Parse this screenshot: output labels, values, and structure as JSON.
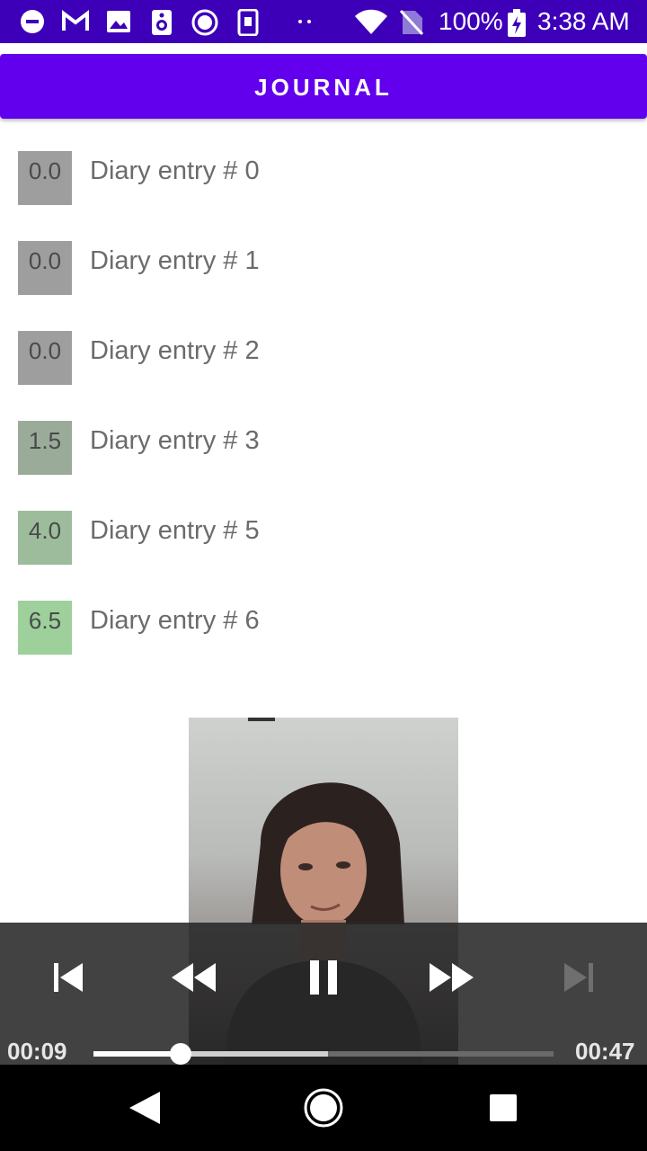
{
  "status_bar": {
    "icons": [
      "minus-circle-icon",
      "gmail-icon",
      "image-icon",
      "speaker-icon",
      "record-icon",
      "phone-device-icon",
      "dots-icon",
      "wifi-icon",
      "no-sim-icon",
      "battery-icon"
    ],
    "battery_text": "100%",
    "time": "3:38 AM",
    "background": "#3d00b8"
  },
  "app_bar": {
    "title": "JOURNAL",
    "color": "#6200ee"
  },
  "entries": [
    {
      "score": "0.0",
      "label": "Diary entry # 0",
      "color": "#9e9e9e"
    },
    {
      "score": "0.0",
      "label": "Diary entry # 1",
      "color": "#9e9e9e"
    },
    {
      "score": "0.0",
      "label": "Diary entry # 2",
      "color": "#9e9e9e"
    },
    {
      "score": "1.5",
      "label": "Diary entry # 3",
      "color": "#9aab9a"
    },
    {
      "score": "4.0",
      "label": "Diary entry # 5",
      "color": "#9dbc9c"
    },
    {
      "score": "6.5",
      "label": "Diary entry # 6",
      "color": "#9dd09a"
    }
  ],
  "player": {
    "current_time": "00:09",
    "duration": "00:47",
    "played_fraction": 0.19,
    "buffered_fraction": 0.51,
    "controls": [
      "skip-previous-icon",
      "rewind-icon",
      "pause-icon",
      "fast-forward-icon",
      "skip-next-icon"
    ]
  },
  "nav_bar": {
    "buttons": [
      "back-icon",
      "home-icon",
      "recents-icon"
    ]
  }
}
